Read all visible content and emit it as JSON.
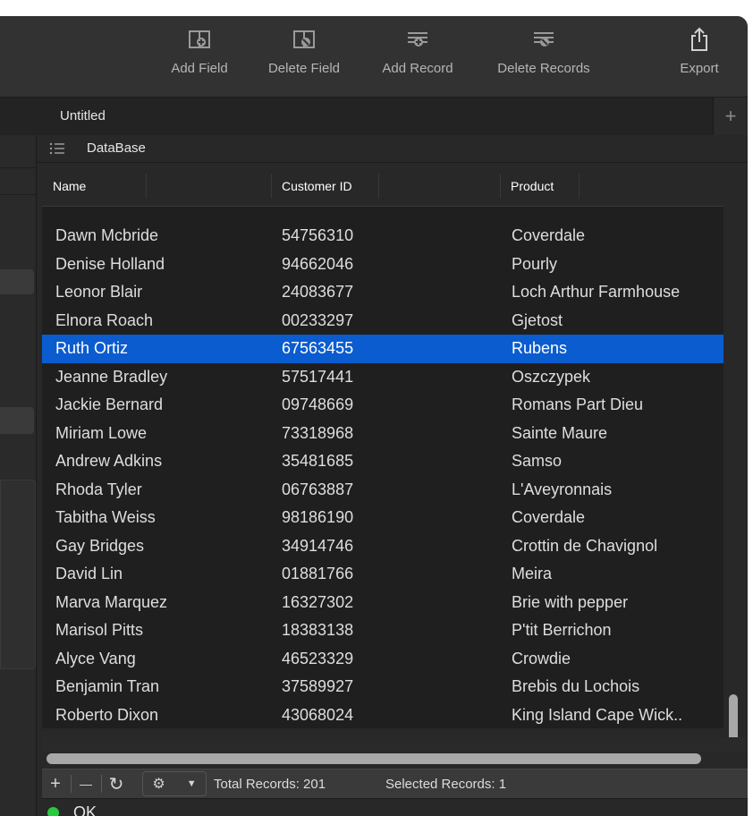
{
  "toolbar": {
    "add_field": "Add Field",
    "delete_field": "Delete Field",
    "add_record": "Add Record",
    "delete_records": "Delete Records",
    "export": "Export"
  },
  "tabs": {
    "active": "Untitled",
    "add": "+"
  },
  "database": {
    "title": "DataBase"
  },
  "table": {
    "columns": [
      "Name",
      "Customer ID",
      "Product"
    ],
    "rows": [
      {
        "name": "Dawn Mcbride",
        "id": "54756310",
        "product": "Coverdale"
      },
      {
        "name": "Denise Holland",
        "id": "94662046",
        "product": "Pourly"
      },
      {
        "name": "Leonor Blair",
        "id": "24083677",
        "product": "Loch Arthur Farmhouse"
      },
      {
        "name": "Elnora Roach",
        "id": "00233297",
        "product": "Gjetost"
      },
      {
        "name": "Ruth Ortiz",
        "id": "67563455",
        "product": "Rubens"
      },
      {
        "name": "Jeanne Bradley",
        "id": "57517441",
        "product": "Oszczypek"
      },
      {
        "name": "Jackie Bernard",
        "id": "09748669",
        "product": "Romans Part Dieu"
      },
      {
        "name": "Miriam Lowe",
        "id": "73318968",
        "product": "Sainte Maure"
      },
      {
        "name": "Andrew Adkins",
        "id": "35481685",
        "product": "Samso"
      },
      {
        "name": "Rhoda Tyler",
        "id": "06763887",
        "product": "L'Aveyronnais"
      },
      {
        "name": "Tabitha Weiss",
        "id": "98186190",
        "product": "Coverdale"
      },
      {
        "name": "Gay Bridges",
        "id": "34914746",
        "product": "Crottin de Chavignol"
      },
      {
        "name": "David Lin",
        "id": "01881766",
        "product": "Meira"
      },
      {
        "name": "Marva Marquez",
        "id": "16327302",
        "product": "Brie with pepper"
      },
      {
        "name": "Marisol Pitts",
        "id": "18383138",
        "product": "P'tit Berrichon"
      },
      {
        "name": "Alyce Vang",
        "id": "46523329",
        "product": "Crowdie"
      },
      {
        "name": "Benjamin Tran",
        "id": "37589927",
        "product": "Brebis du Lochois"
      },
      {
        "name": "Roberto Dixon",
        "id": "43068024",
        "product": "King Island Cape Wick.."
      }
    ],
    "selected_index": 4
  },
  "bottombar": {
    "add": "+",
    "remove": "—",
    "refresh": "↻",
    "total_records": "Total Records: 201",
    "selected_records": "Selected Records: 1"
  },
  "status": {
    "text": "OK",
    "color": "#27c93f"
  },
  "colors": {
    "selection": "#0a5ccf",
    "background": "#282828"
  }
}
